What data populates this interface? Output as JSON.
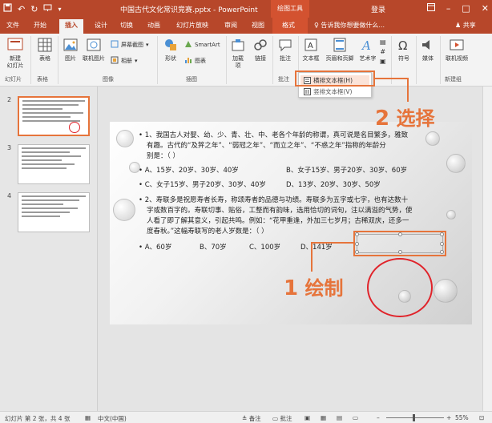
{
  "titlebar": {
    "document_title": "中国古代文化常识竞赛.pptx - PowerPoint",
    "contextual_tools": "绘图工具",
    "login": "登录",
    "accent_color": "#b7472a"
  },
  "tabs": [
    "文件",
    "开始",
    "插入",
    "设计",
    "切换",
    "动画",
    "幻灯片放映",
    "审阅",
    "视图",
    "格式"
  ],
  "tell_me": "告诉我你想要做什么...",
  "share": "共享",
  "ribbon": {
    "new_slide": "新建\n幻灯片",
    "table": "表格",
    "picture": "图片",
    "online_picture": "联机图片",
    "screenshot": "屏幕截图",
    "album": "相册",
    "shapes": "形状",
    "smartart": "SmartArt",
    "chart": "图表",
    "addins": "加载\n项",
    "link": "链接",
    "comment": "批注",
    "textbox": "文本框",
    "header_footer": "页眉和页脚",
    "wordart": "艺术字",
    "symbol": "符号",
    "media": "媒体",
    "online_video": "联机视频",
    "groups": {
      "slides": "幻灯片",
      "tables": "表格",
      "images": "图像",
      "illustrations": "插图",
      "comments": "批注",
      "new_group": "新建组"
    }
  },
  "dropdown": {
    "item1": "横排文本框(H)",
    "item2": "竖排文本框(V)"
  },
  "callouts": {
    "select_num": "2",
    "select_text": "选择",
    "draw_num": "1",
    "draw_text": "绘制"
  },
  "slides_panel": {
    "numbers": [
      "2",
      "3",
      "4"
    ]
  },
  "slide": {
    "q1_line1": "• 1、我国古人对婴、幼、少、青、壮、中、老各个年龄的称谓，真可说是名目繁多，雅致",
    "q1_line2": "有趣。古代的“及笄之年”、“弱冠之年”、“而立之年”、“不惑之年”指称的年龄分",
    "q1_line3": "别是：（   ）",
    "q1_a": "A、15岁、20岁、30岁、40岁",
    "q1_b": "B、女子15岁、男子20岁、30岁、60岁",
    "q1_c": "C、女子15岁、男子20岁、30岁、40岁",
    "q1_d": "D、13岁、20岁、30岁、50岁",
    "q2_line1": "• 2、寿联多是祝愿寿者长寿，称颂寿者的品德与功绩。寿联多为五字或七字，也有达数十",
    "q2_line2": "字或数百字的。寿联切事、贴俗，工整而有韵味，选用恰切的词句，注以满溢的气势，使",
    "q2_line3": "人看了即了解其意义，引起共鸣。例如：“花甲重逢，外加三七岁月；古稀双庆，还多一",
    "q2_line4": "度春秋。”这幅寿联写的老人岁数是：（   ）",
    "q2_a": "A、60岁",
    "q2_b": "B、70岁",
    "q2_c": "C、100岁",
    "q2_d": "D、141岁"
  },
  "statusbar": {
    "slide_info": "幻灯片 第 2 张，共 4 张",
    "language": "中文(中国)",
    "notes": "备注",
    "comments": "批注",
    "zoom": "55%"
  }
}
